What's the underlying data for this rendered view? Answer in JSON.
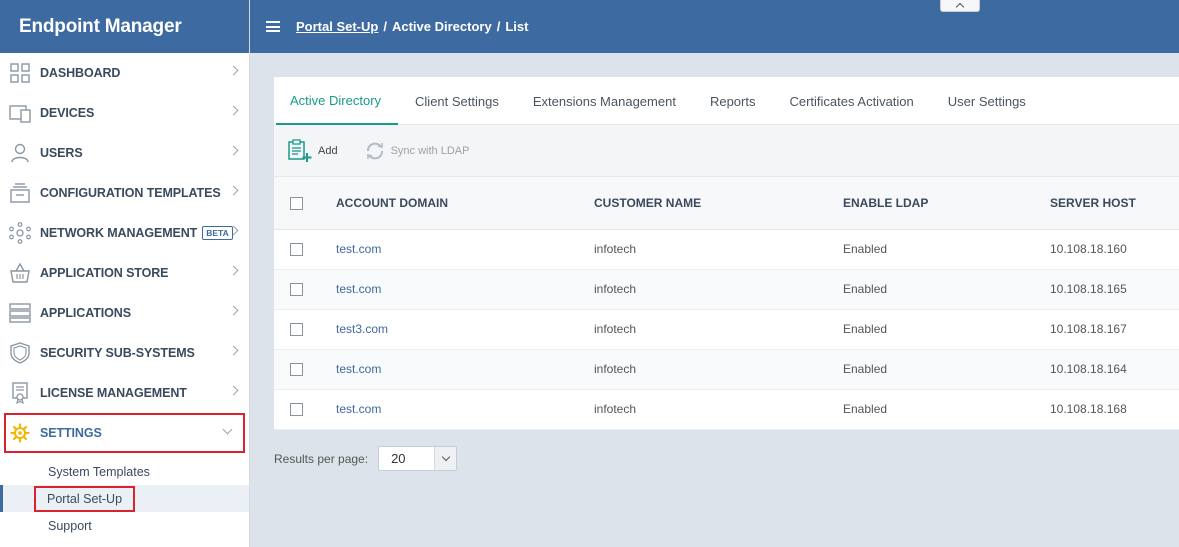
{
  "app": {
    "title": "Endpoint Manager"
  },
  "sidebar": {
    "items": [
      {
        "label": "DASHBOARD",
        "icon": "dashboard-icon"
      },
      {
        "label": "DEVICES",
        "icon": "devices-icon"
      },
      {
        "label": "USERS",
        "icon": "users-icon"
      },
      {
        "label": "CONFIGURATION TEMPLATES",
        "icon": "configuration-templates-icon"
      },
      {
        "label": "NETWORK MANAGEMENT",
        "icon": "network-management-icon",
        "badge": "BETA"
      },
      {
        "label": "APPLICATION STORE",
        "icon": "application-store-icon"
      },
      {
        "label": "APPLICATIONS",
        "icon": "applications-icon"
      },
      {
        "label": "SECURITY SUB-SYSTEMS",
        "icon": "shield-icon"
      },
      {
        "label": "LICENSE MANAGEMENT",
        "icon": "license-icon"
      },
      {
        "label": "SETTINGS",
        "icon": "gear-icon"
      }
    ],
    "settings_sub": [
      {
        "label": "System Templates"
      },
      {
        "label": "Portal Set-Up"
      },
      {
        "label": "Support"
      }
    ]
  },
  "breadcrumb": {
    "items": [
      "Portal Set-Up",
      "Active Directory",
      "List"
    ]
  },
  "tabs": [
    {
      "label": "Active Directory"
    },
    {
      "label": "Client Settings"
    },
    {
      "label": "Extensions Management"
    },
    {
      "label": "Reports"
    },
    {
      "label": "Certificates Activation"
    },
    {
      "label": "User Settings"
    }
  ],
  "toolbar": {
    "add_label": "Add",
    "sync_label": "Sync with LDAP"
  },
  "table": {
    "columns": [
      "ACCOUNT DOMAIN",
      "CUSTOMER NAME",
      "ENABLE LDAP",
      "SERVER HOST"
    ],
    "rows": [
      {
        "domain": "test.com",
        "customer": "infotech",
        "ldap": "Enabled",
        "host": "10.108.18.160"
      },
      {
        "domain": "test.com",
        "customer": "infotech",
        "ldap": "Enabled",
        "host": "10.108.18.165"
      },
      {
        "domain": "test3.com",
        "customer": "infotech",
        "ldap": "Enabled",
        "host": "10.108.18.167"
      },
      {
        "domain": "test.com",
        "customer": "infotech",
        "ldap": "Enabled",
        "host": "10.108.18.164"
      },
      {
        "domain": "test.com",
        "customer": "infotech",
        "ldap": "Enabled",
        "host": "10.108.18.168"
      }
    ]
  },
  "pager": {
    "label": "Results per page:",
    "value": "20"
  },
  "colors": {
    "brand": "#3d6aa0",
    "accent": "#1a9a8a",
    "highlight": "#d9232f",
    "gear": "#f2b705"
  }
}
